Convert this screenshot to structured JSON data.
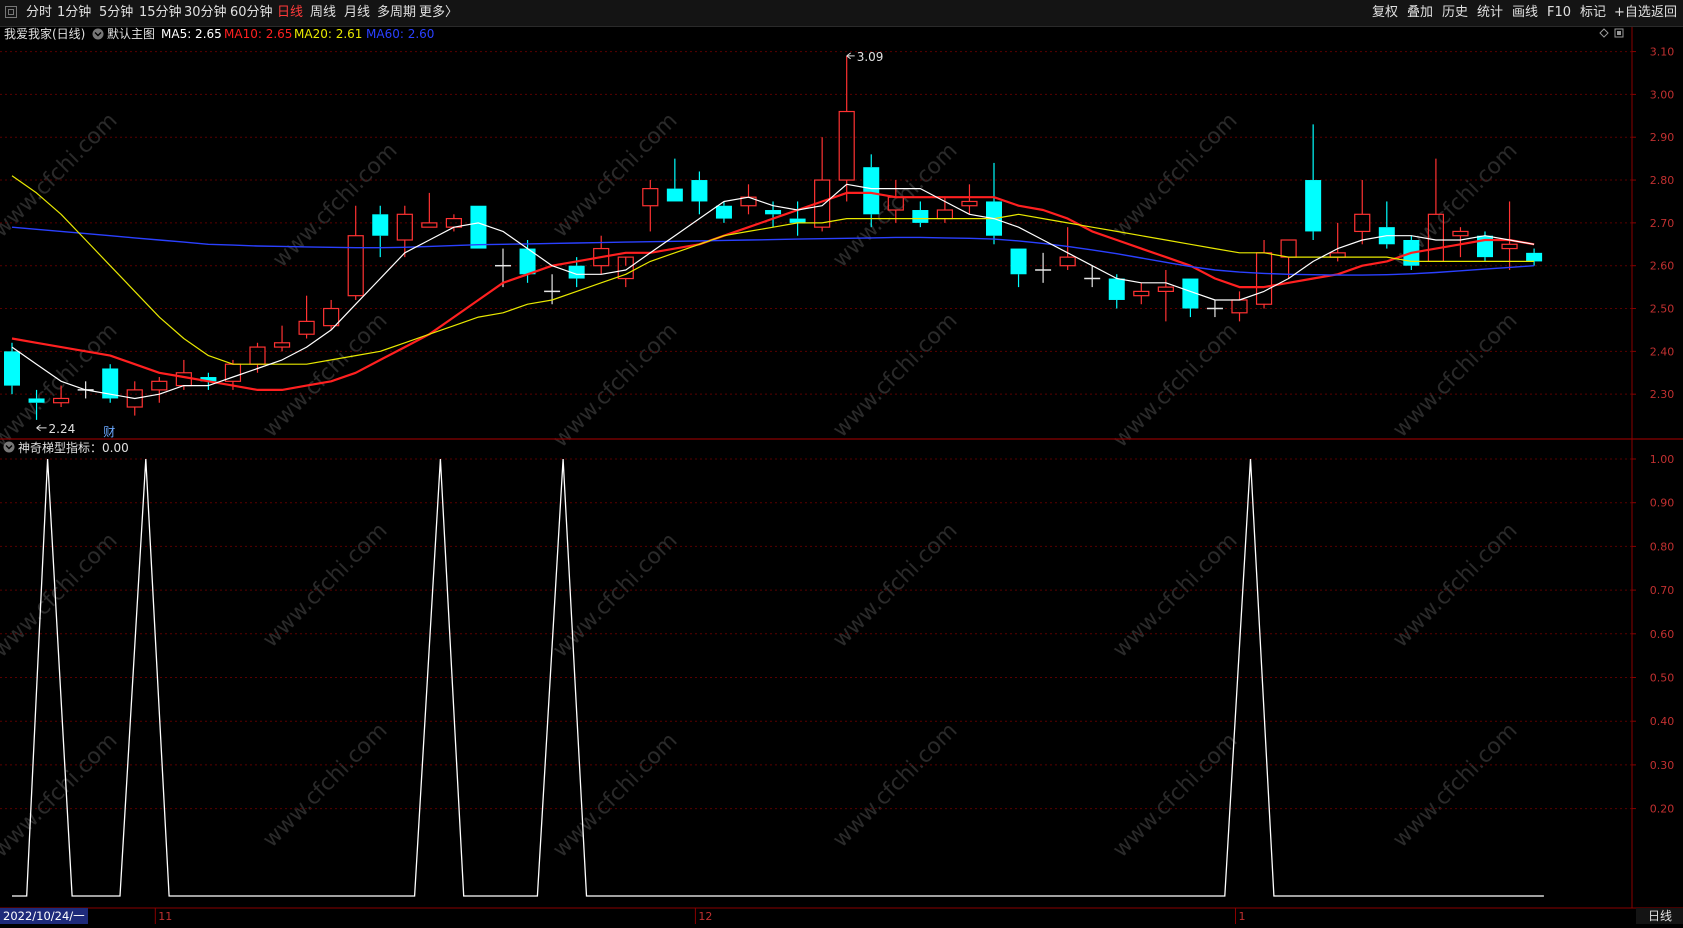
{
  "toolbar": {
    "left_items": [
      {
        "name": "period-fenshi",
        "label": "分时",
        "active": false
      },
      {
        "name": "period-1min",
        "label": "1分钟",
        "active": false
      },
      {
        "name": "period-5min",
        "label": "5分钟",
        "active": false
      },
      {
        "name": "period-15min",
        "label": "15分钟",
        "active": false
      },
      {
        "name": "period-30min",
        "label": "30分钟",
        "active": false
      },
      {
        "name": "period-60min",
        "label": "60分钟",
        "active": false
      },
      {
        "name": "period-daily",
        "label": "日线",
        "active": true
      },
      {
        "name": "period-weekly",
        "label": "周线",
        "active": false
      },
      {
        "name": "period-monthly",
        "label": "月线",
        "active": false
      },
      {
        "name": "period-multi",
        "label": "多周期",
        "active": false
      },
      {
        "name": "period-more",
        "label": "更多〉",
        "active": false
      }
    ],
    "right_items": [
      {
        "name": "fuquan",
        "label": "复权"
      },
      {
        "name": "diejia",
        "label": "叠加"
      },
      {
        "name": "lishi",
        "label": "历史"
      },
      {
        "name": "tongji",
        "label": "统计"
      },
      {
        "name": "huaxian",
        "label": "画线"
      },
      {
        "name": "f10",
        "label": "F10"
      },
      {
        "name": "biaoji",
        "label": "标记"
      },
      {
        "name": "zixuan",
        "label": "+自选"
      },
      {
        "name": "fanhui",
        "label": "返回"
      }
    ]
  },
  "main_panel": {
    "stock_title": "我爱我家(日线)",
    "indicator_name": "默认主图",
    "ma_labels": [
      {
        "text": "MA5: 2.65",
        "color": "#ffffff"
      },
      {
        "text": "MA10: 2.65",
        "color": "#ff2020"
      },
      {
        "text": "MA20: 2.61",
        "color": "#e8e800"
      },
      {
        "text": "MA60: 2.60",
        "color": "#2a40ff"
      }
    ],
    "high_annotation": "3.09",
    "low_annotation": "2.24",
    "cai_marker": "财",
    "watermark": "www.cfchi.com"
  },
  "sub_panel": {
    "indicator_title": "神奇梯型指标：0.00"
  },
  "x_axis": {
    "date_label": "2022/10/24/一",
    "month_labels": [
      {
        "text": "11",
        "index": 6
      },
      {
        "text": "12",
        "index": 28
      },
      {
        "text": "1",
        "index": 50
      }
    ],
    "period_label": "日线"
  },
  "colors": {
    "up": "#ff3232",
    "down": "#00ffff",
    "ma5": "#ffffff",
    "ma10": "#ff2020",
    "ma20": "#e8e800",
    "ma60": "#2a40ff",
    "grid": "#5a0000",
    "axis": "#8a0000",
    "axis_text": "#c03030",
    "indicator": "#ffffff"
  },
  "chart_data": [
    {
      "type": "candlestick",
      "title": "我爱我家(日线)",
      "y_ticks": [
        3.1,
        3.0,
        2.9,
        2.8,
        2.7,
        2.6,
        2.5,
        2.4,
        2.3
      ],
      "ylim": [
        2.2,
        3.14
      ],
      "candles": [
        {
          "o": 2.4,
          "h": 2.42,
          "l": 2.3,
          "c": 2.32
        },
        {
          "o": 2.29,
          "h": 2.31,
          "l": 2.24,
          "c": 2.28
        },
        {
          "o": 2.28,
          "h": 2.32,
          "l": 2.27,
          "c": 2.29
        },
        {
          "o": 2.31,
          "h": 2.33,
          "l": 2.29,
          "c": 2.31
        },
        {
          "o": 2.36,
          "h": 2.37,
          "l": 2.28,
          "c": 2.29
        },
        {
          "o": 2.27,
          "h": 2.33,
          "l": 2.25,
          "c": 2.31
        },
        {
          "o": 2.31,
          "h": 2.34,
          "l": 2.28,
          "c": 2.33
        },
        {
          "o": 2.32,
          "h": 2.38,
          "l": 2.31,
          "c": 2.35
        },
        {
          "o": 2.34,
          "h": 2.35,
          "l": 2.31,
          "c": 2.33
        },
        {
          "o": 2.33,
          "h": 2.38,
          "l": 2.31,
          "c": 2.37
        },
        {
          "o": 2.37,
          "h": 2.42,
          "l": 2.35,
          "c": 2.41
        },
        {
          "o": 2.41,
          "h": 2.46,
          "l": 2.4,
          "c": 2.42
        },
        {
          "o": 2.44,
          "h": 2.53,
          "l": 2.43,
          "c": 2.47
        },
        {
          "o": 2.46,
          "h": 2.52,
          "l": 2.45,
          "c": 2.5
        },
        {
          "o": 2.53,
          "h": 2.74,
          "l": 2.52,
          "c": 2.67
        },
        {
          "o": 2.72,
          "h": 2.74,
          "l": 2.62,
          "c": 2.67
        },
        {
          "o": 2.66,
          "h": 2.74,
          "l": 2.62,
          "c": 2.72
        },
        {
          "o": 2.69,
          "h": 2.77,
          "l": 2.69,
          "c": 2.7
        },
        {
          "o": 2.69,
          "h": 2.72,
          "l": 2.68,
          "c": 2.71
        },
        {
          "o": 2.74,
          "h": 2.74,
          "l": 2.64,
          "c": 2.64
        },
        {
          "o": 2.6,
          "h": 2.64,
          "l": 2.55,
          "c": 2.6
        },
        {
          "o": 2.64,
          "h": 2.66,
          "l": 2.56,
          "c": 2.58
        },
        {
          "o": 2.54,
          "h": 2.58,
          "l": 2.51,
          "c": 2.54
        },
        {
          "o": 2.6,
          "h": 2.62,
          "l": 2.55,
          "c": 2.57
        },
        {
          "o": 2.6,
          "h": 2.67,
          "l": 2.58,
          "c": 2.64
        },
        {
          "o": 2.57,
          "h": 2.6,
          "l": 2.55,
          "c": 2.62
        },
        {
          "o": 2.74,
          "h": 2.8,
          "l": 2.68,
          "c": 2.78
        },
        {
          "o": 2.78,
          "h": 2.85,
          "l": 2.75,
          "c": 2.75
        },
        {
          "o": 2.8,
          "h": 2.82,
          "l": 2.72,
          "c": 2.75
        },
        {
          "o": 2.74,
          "h": 2.75,
          "l": 2.7,
          "c": 2.71
        },
        {
          "o": 2.74,
          "h": 2.79,
          "l": 2.72,
          "c": 2.76
        },
        {
          "o": 2.73,
          "h": 2.75,
          "l": 2.69,
          "c": 2.72
        },
        {
          "o": 2.71,
          "h": 2.75,
          "l": 2.67,
          "c": 2.7
        },
        {
          "o": 2.69,
          "h": 2.9,
          "l": 2.68,
          "c": 2.8
        },
        {
          "o": 2.8,
          "h": 3.09,
          "l": 2.75,
          "c": 2.96
        },
        {
          "o": 2.83,
          "h": 2.86,
          "l": 2.69,
          "c": 2.72
        },
        {
          "o": 2.73,
          "h": 2.8,
          "l": 2.7,
          "c": 2.76
        },
        {
          "o": 2.73,
          "h": 2.75,
          "l": 2.69,
          "c": 2.7
        },
        {
          "o": 2.71,
          "h": 2.76,
          "l": 2.7,
          "c": 2.73
        },
        {
          "o": 2.74,
          "h": 2.79,
          "l": 2.72,
          "c": 2.75
        },
        {
          "o": 2.75,
          "h": 2.84,
          "l": 2.65,
          "c": 2.67
        },
        {
          "o": 2.64,
          "h": 2.64,
          "l": 2.55,
          "c": 2.58
        },
        {
          "o": 2.59,
          "h": 2.63,
          "l": 2.56,
          "c": 2.59
        },
        {
          "o": 2.6,
          "h": 2.69,
          "l": 2.59,
          "c": 2.62
        },
        {
          "o": 2.57,
          "h": 2.6,
          "l": 2.55,
          "c": 2.57
        },
        {
          "o": 2.57,
          "h": 2.58,
          "l": 2.5,
          "c": 2.52
        },
        {
          "o": 2.53,
          "h": 2.56,
          "l": 2.51,
          "c": 2.54
        },
        {
          "o": 2.54,
          "h": 2.59,
          "l": 2.47,
          "c": 2.55
        },
        {
          "o": 2.57,
          "h": 2.57,
          "l": 2.48,
          "c": 2.5
        },
        {
          "o": 2.5,
          "h": 2.52,
          "l": 2.48,
          "c": 2.5
        },
        {
          "o": 2.49,
          "h": 2.54,
          "l": 2.47,
          "c": 2.52
        },
        {
          "o": 2.51,
          "h": 2.66,
          "l": 2.5,
          "c": 2.63
        },
        {
          "o": 2.62,
          "h": 2.66,
          "l": 2.57,
          "c": 2.66
        },
        {
          "o": 2.8,
          "h": 2.93,
          "l": 2.66,
          "c": 2.68
        },
        {
          "o": 2.62,
          "h": 2.7,
          "l": 2.61,
          "c": 2.63
        },
        {
          "o": 2.68,
          "h": 2.8,
          "l": 2.65,
          "c": 2.72
        },
        {
          "o": 2.69,
          "h": 2.75,
          "l": 2.64,
          "c": 2.65
        },
        {
          "o": 2.66,
          "h": 2.67,
          "l": 2.59,
          "c": 2.6
        },
        {
          "o": 2.61,
          "h": 2.85,
          "l": 2.61,
          "c": 2.72
        },
        {
          "o": 2.67,
          "h": 2.69,
          "l": 2.62,
          "c": 2.68
        },
        {
          "o": 2.67,
          "h": 2.68,
          "l": 2.61,
          "c": 2.62
        },
        {
          "o": 2.64,
          "h": 2.75,
          "l": 2.59,
          "c": 2.65
        },
        {
          "o": 2.63,
          "h": 2.64,
          "l": 2.6,
          "c": 2.61
        }
      ],
      "series": [
        {
          "name": "MA5",
          "values": [
            2.41,
            2.37,
            2.33,
            2.31,
            2.3,
            2.29,
            2.3,
            2.32,
            2.32,
            2.34,
            2.36,
            2.38,
            2.41,
            2.45,
            2.51,
            2.57,
            2.63,
            2.66,
            2.69,
            2.7,
            2.68,
            2.64,
            2.6,
            2.58,
            2.58,
            2.59,
            2.63,
            2.67,
            2.71,
            2.75,
            2.76,
            2.74,
            2.73,
            2.74,
            2.79,
            2.78,
            2.78,
            2.78,
            2.75,
            2.72,
            2.71,
            2.69,
            2.66,
            2.63,
            2.6,
            2.57,
            2.56,
            2.56,
            2.54,
            2.52,
            2.52,
            2.54,
            2.57,
            2.61,
            2.64,
            2.66,
            2.67,
            2.67,
            2.66,
            2.66,
            2.67,
            2.66,
            2.65
          ]
        },
        {
          "name": "MA10",
          "values": [
            2.43,
            2.42,
            2.41,
            2.4,
            2.39,
            2.37,
            2.35,
            2.34,
            2.33,
            2.32,
            2.31,
            2.31,
            2.32,
            2.33,
            2.35,
            2.38,
            2.41,
            2.44,
            2.48,
            2.52,
            2.56,
            2.58,
            2.6,
            2.61,
            2.62,
            2.63,
            2.63,
            2.64,
            2.65,
            2.67,
            2.69,
            2.71,
            2.73,
            2.75,
            2.77,
            2.77,
            2.76,
            2.76,
            2.76,
            2.76,
            2.76,
            2.74,
            2.73,
            2.71,
            2.68,
            2.66,
            2.64,
            2.62,
            2.6,
            2.57,
            2.55,
            2.55,
            2.56,
            2.57,
            2.58,
            2.6,
            2.61,
            2.63,
            2.64,
            2.65,
            2.66,
            2.66,
            2.65
          ]
        },
        {
          "name": "MA20",
          "values": [
            2.81,
            2.77,
            2.72,
            2.66,
            2.6,
            2.54,
            2.48,
            2.43,
            2.39,
            2.37,
            2.37,
            2.37,
            2.37,
            2.38,
            2.39,
            2.4,
            2.42,
            2.44,
            2.46,
            2.48,
            2.49,
            2.51,
            2.52,
            2.54,
            2.56,
            2.58,
            2.61,
            2.63,
            2.65,
            2.67,
            2.68,
            2.69,
            2.7,
            2.7,
            2.71,
            2.71,
            2.71,
            2.71,
            2.71,
            2.71,
            2.71,
            2.72,
            2.71,
            2.7,
            2.69,
            2.68,
            2.67,
            2.66,
            2.65,
            2.64,
            2.63,
            2.63,
            2.62,
            2.62,
            2.62,
            2.62,
            2.62,
            2.61,
            2.61,
            2.61,
            2.61,
            2.61,
            2.61
          ]
        },
        {
          "name": "MA60",
          "values": [
            2.69,
            2.685,
            2.68,
            2.675,
            2.67,
            2.665,
            2.66,
            2.655,
            2.65,
            2.648,
            2.646,
            2.645,
            2.644,
            2.643,
            2.642,
            2.642,
            2.643,
            2.645,
            2.647,
            2.649,
            2.65,
            2.651,
            2.652,
            2.653,
            2.654,
            2.655,
            2.656,
            2.657,
            2.658,
            2.659,
            2.66,
            2.661,
            2.662,
            2.663,
            2.664,
            2.665,
            2.666,
            2.666,
            2.665,
            2.664,
            2.662,
            2.658,
            2.652,
            2.645,
            2.637,
            2.628,
            2.618,
            2.608,
            2.598,
            2.59,
            2.585,
            2.582,
            2.58,
            2.579,
            2.578,
            2.578,
            2.579,
            2.581,
            2.584,
            2.588,
            2.592,
            2.596,
            2.6
          ]
        }
      ]
    },
    {
      "type": "line",
      "title": "神奇梯型指标：0.00",
      "y_ticks": [
        1.0,
        0.9,
        0.8,
        0.7,
        0.6,
        0.5,
        0.4,
        0.3,
        0.2
      ],
      "ylim": [
        0,
        1.0
      ],
      "series": [
        {
          "name": "神奇梯型指标",
          "points": [
            [
              0,
              0
            ],
            [
              0.6,
              0
            ],
            [
              1.45,
              1
            ],
            [
              2.45,
              0
            ],
            [
              4.4,
              0
            ],
            [
              5.45,
              1
            ],
            [
              6.4,
              0
            ],
            [
              16.4,
              0
            ],
            [
              17.45,
              1
            ],
            [
              18.4,
              0
            ],
            [
              21.4,
              0
            ],
            [
              22.45,
              1
            ],
            [
              23.4,
              0
            ],
            [
              49.4,
              0
            ],
            [
              50.45,
              1
            ],
            [
              51.4,
              0
            ],
            [
              62.4,
              0
            ]
          ]
        }
      ]
    }
  ]
}
